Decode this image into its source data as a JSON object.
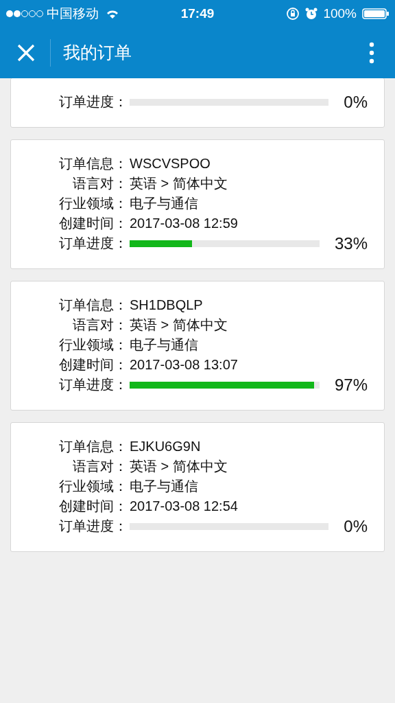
{
  "status_bar": {
    "carrier": "中国移动",
    "time": "17:49",
    "battery": "100%"
  },
  "nav": {
    "title": "我的订单"
  },
  "orders": [
    {
      "progress": {
        "label": "订单进度：",
        "level": 0,
        "reading": "0%"
      }
    },
    {
      "fields": [
        {
          "label": "订单信息：",
          "value": "WSCVSPOO"
        },
        {
          "label": "语言对：",
          "value": "英语 > 简体中文"
        },
        {
          "label": "行业领域：",
          "value": "电子与通信"
        },
        {
          "label": "创建时间：",
          "value": "2017-03-08 12:59"
        }
      ],
      "progress": {
        "label": "订单进度：",
        "level": 0.33,
        "reading": "33%"
      }
    },
    {
      "fields": [
        {
          "label": "订单信息：",
          "value": "SH1DBQLP"
        },
        {
          "label": "语言对：",
          "value": "英语 > 简体中文"
        },
        {
          "label": "行业领域：",
          "value": "电子与通信"
        },
        {
          "label": "创建时间：",
          "value": "2017-03-08 13:07"
        }
      ],
      "progress": {
        "label": "订单进度：",
        "level": 0.97,
        "reading": "97%"
      }
    },
    {
      "fields": [
        {
          "label": "订单信息：",
          "value": "EJKU6G9N"
        },
        {
          "label": "语言对：",
          "value": "英语 > 简体中文"
        },
        {
          "label": "行业领域：",
          "value": "电子与通信"
        },
        {
          "label": "创建时间：",
          "value": "2017-03-08 12:54"
        }
      ],
      "progress": {
        "label": "订单进度：",
        "level": 0,
        "reading": "0%"
      }
    }
  ]
}
